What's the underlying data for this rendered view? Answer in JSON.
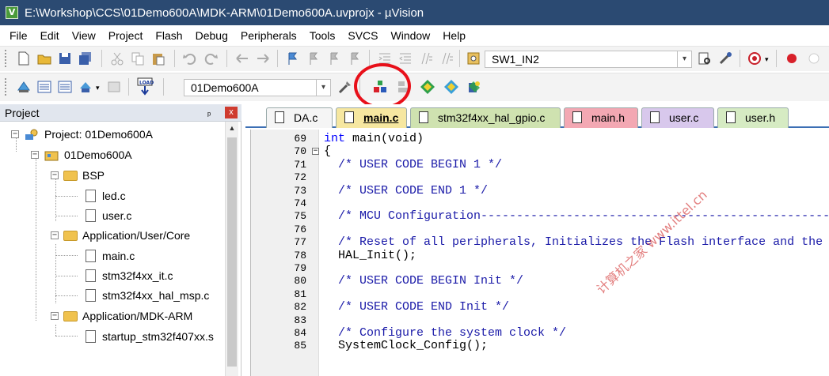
{
  "window": {
    "title": "E:\\Workshop\\CCS\\01Demo600A\\MDK-ARM\\01Demo600A.uvprojx - µVision"
  },
  "menu": {
    "items": [
      "File",
      "Edit",
      "View",
      "Project",
      "Flash",
      "Debug",
      "Peripherals",
      "Tools",
      "SVCS",
      "Window",
      "Help"
    ]
  },
  "toolbar1": {
    "find_value": "SW1_IN2"
  },
  "toolbar2": {
    "target_value": "01Demo600A"
  },
  "project_panel": {
    "title": "Project",
    "pin": "ᵖ",
    "close": "x",
    "tree": [
      {
        "label": "Project: 01Demo600A",
        "kind": "project"
      },
      {
        "label": "01Demo600A",
        "kind": "target"
      },
      {
        "label": "BSP",
        "kind": "folder"
      },
      {
        "label": "led.c",
        "kind": "file"
      },
      {
        "label": "user.c",
        "kind": "file"
      },
      {
        "label": "Application/User/Core",
        "kind": "folder"
      },
      {
        "label": "main.c",
        "kind": "file"
      },
      {
        "label": "stm32f4xx_it.c",
        "kind": "file"
      },
      {
        "label": "stm32f4xx_hal_msp.c",
        "kind": "file"
      },
      {
        "label": "Application/MDK-ARM",
        "kind": "folder"
      },
      {
        "label": "startup_stm32f407xx.s",
        "kind": "file"
      }
    ]
  },
  "tabs": [
    {
      "label": "DA.c",
      "color": "#f5f5f5"
    },
    {
      "label": "main.c",
      "color": "#f6e7a0"
    },
    {
      "label": "stm32f4xx_hal_gpio.c",
      "color": "#cfe2b0"
    },
    {
      "label": "main.h",
      "color": "#f3a8b3"
    },
    {
      "label": "user.c",
      "color": "#d8c8ec"
    },
    {
      "label": "user.h",
      "color": "#d6ebc3"
    }
  ],
  "editor": {
    "lines": [
      {
        "n": "69",
        "text": "int main(void)"
      },
      {
        "n": "70",
        "text": "{"
      },
      {
        "n": "71",
        "text": "  /* USER CODE BEGIN 1 */"
      },
      {
        "n": "72",
        "text": ""
      },
      {
        "n": "73",
        "text": "  /* USER CODE END 1 */"
      },
      {
        "n": "74",
        "text": ""
      },
      {
        "n": "75",
        "text": "  /* MCU Configuration--------------------------------------------------------"
      },
      {
        "n": "76",
        "text": ""
      },
      {
        "n": "77",
        "text": "  /* Reset of all peripherals, Initializes the Flash interface and the S"
      },
      {
        "n": "78",
        "text": "  HAL_Init();"
      },
      {
        "n": "79",
        "text": ""
      },
      {
        "n": "80",
        "text": "  /* USER CODE BEGIN Init */"
      },
      {
        "n": "81",
        "text": ""
      },
      {
        "n": "82",
        "text": "  /* USER CODE END Init */"
      },
      {
        "n": "83",
        "text": ""
      },
      {
        "n": "84",
        "text": "  /* Configure the system clock */"
      },
      {
        "n": "85",
        "text": "  SystemClock_Config();"
      }
    ]
  },
  "watermark": {
    "text": "计算机之家 www.ittel.cn"
  },
  "colors": {
    "titlebar": "#2b4a72",
    "tab_active_border": "#3c6fb4",
    "highlight_circle": "#e8101a"
  }
}
